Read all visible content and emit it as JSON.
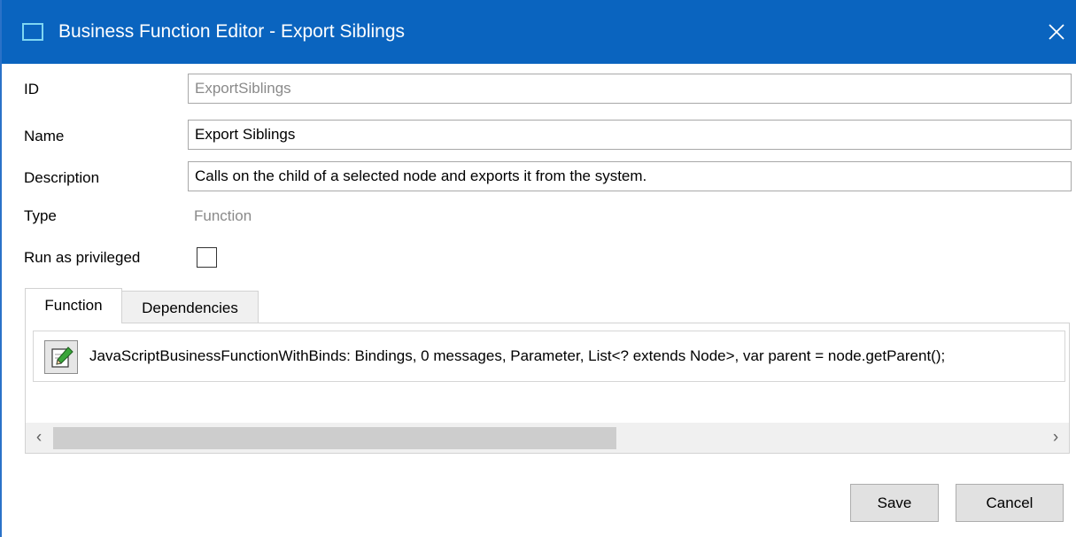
{
  "window": {
    "title": "Business Function Editor - Export Siblings"
  },
  "form": {
    "id_label": "ID",
    "id_value": "ExportSiblings",
    "name_label": "Name",
    "name_value": "Export Siblings",
    "description_label": "Description",
    "description_value": "Calls on the child of a selected node and exports it from the system.",
    "type_label": "Type",
    "type_value": "Function",
    "privileged_label": "Run as privileged",
    "privileged_checked": false
  },
  "tabs": [
    {
      "label": "Function",
      "active": true
    },
    {
      "label": "Dependencies",
      "active": false
    }
  ],
  "function_panel": {
    "entry_text": "JavaScriptBusinessFunctionWithBinds: Bindings, 0 messages, Parameter, List<? extends Node>, var parent = node.getParent();",
    "edit_icon": "edit-pencil-icon",
    "scroll_left_icon": "‹",
    "scroll_right_icon": "›"
  },
  "buttons": {
    "save_label": "Save",
    "cancel_label": "Cancel"
  },
  "colors": {
    "titlebar": "#0a64bf",
    "accent_icon": "#7fd6f2"
  }
}
